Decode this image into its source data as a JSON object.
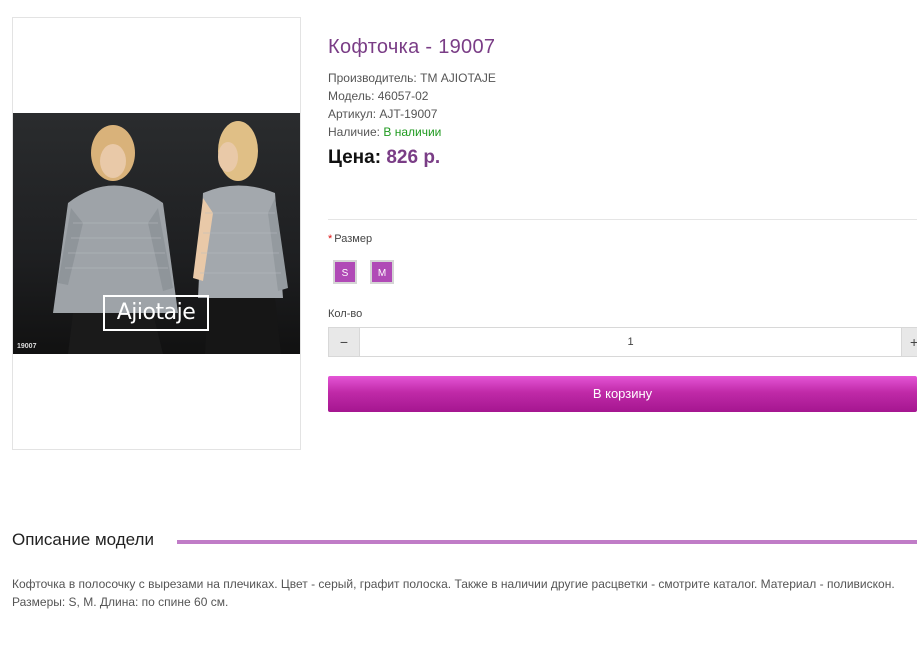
{
  "product": {
    "title": "Кофточка - 19007",
    "manufacturer_label": "Производитель:",
    "manufacturer_value": "ТМ AJIOTAJE",
    "model_label": "Модель:",
    "model_value": "46057-02",
    "sku_label": "Артикул:",
    "sku_value": "AJT-19007",
    "availability_label": "Наличие:",
    "availability_value": "В наличии",
    "price_label": "Цена:",
    "price_value": "826 р."
  },
  "photo": {
    "logo_text": "Ajiotaje",
    "code_text": "19007"
  },
  "options": {
    "size_required_mark": "*",
    "size_label": "Размер",
    "sizes": [
      "S",
      "M"
    ],
    "qty_label": "Кол-во",
    "qty_value": "1",
    "qty_minus": "−",
    "qty_plus": "+",
    "cart_button_label": "В корзину"
  },
  "description": {
    "heading": "Описание модели",
    "text": "Кофточка в полосочку с вырезами на плечиках. Цвет - серый, графит полоска. Также в наличии другие расцветки - смотрите каталог. Материал - поливискон. Размеры: S, M. Длина: по спине 60 см."
  },
  "colors": {
    "accent": "#7a3d86",
    "size_option_bg": "#b04ab6",
    "cart_button": "#c02aa8",
    "in_stock": "#1f9a1f",
    "divider_accent": "#c07cc7"
  }
}
